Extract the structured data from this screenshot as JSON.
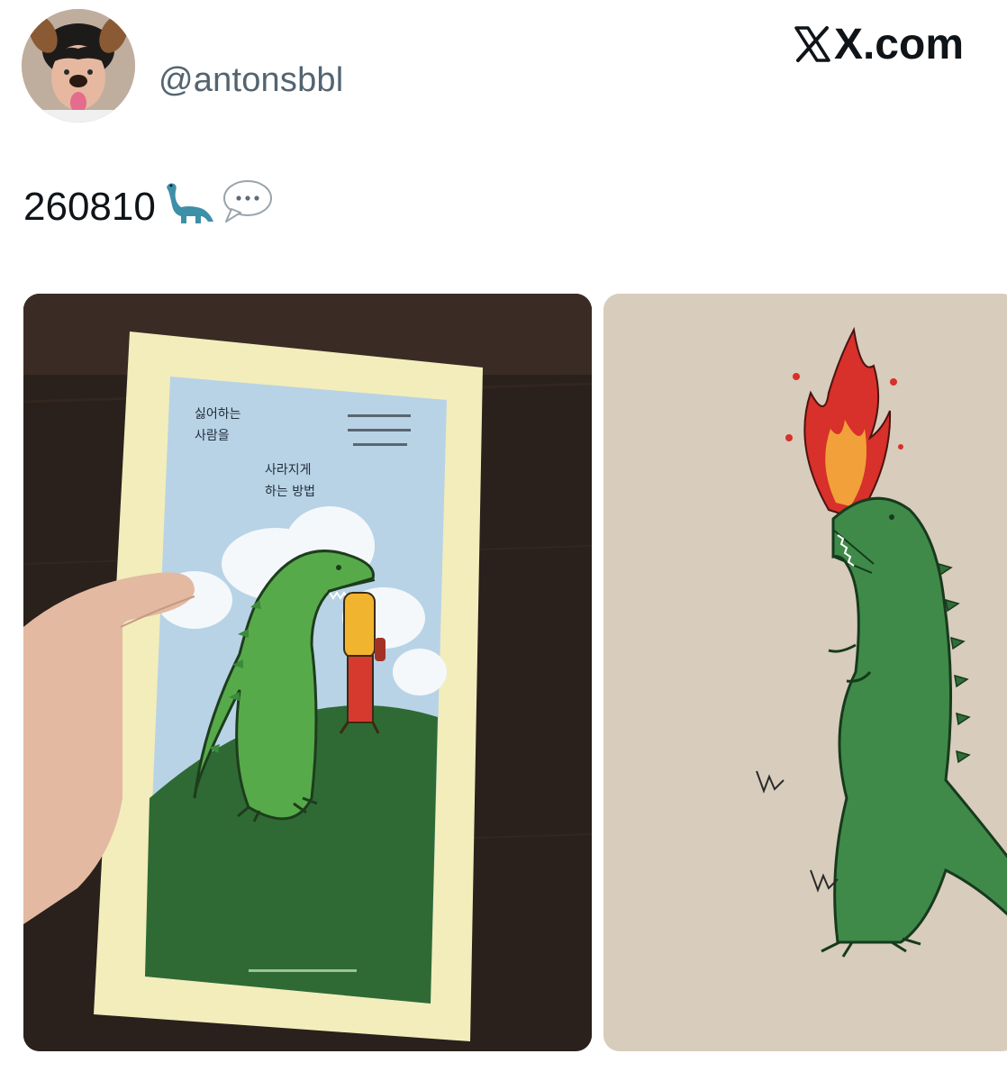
{
  "tweet": {
    "author": {
      "handle": "@antonsbbl",
      "avatar_icon": "profile-avatar"
    },
    "site": "X.com",
    "text": "260810",
    "emojis": [
      "sauropod-emoji",
      "speech-bubble-emoji"
    ],
    "media": [
      {
        "kind": "photo",
        "description_icon": "book-cover-photo",
        "cover_text": {
          "title_line1": "싫어하는",
          "title_line2": "사람을",
          "subtitle_line1": "사라지게",
          "subtitle_line2": "하는 방법"
        }
      },
      {
        "kind": "photo",
        "description_icon": "dinosaur-illustration-photo"
      }
    ]
  },
  "colors": {
    "text": "#0f1419",
    "secondary_text": "#536471",
    "dino_green": "#3f9b4a",
    "book_frame": "#f3efbd"
  }
}
